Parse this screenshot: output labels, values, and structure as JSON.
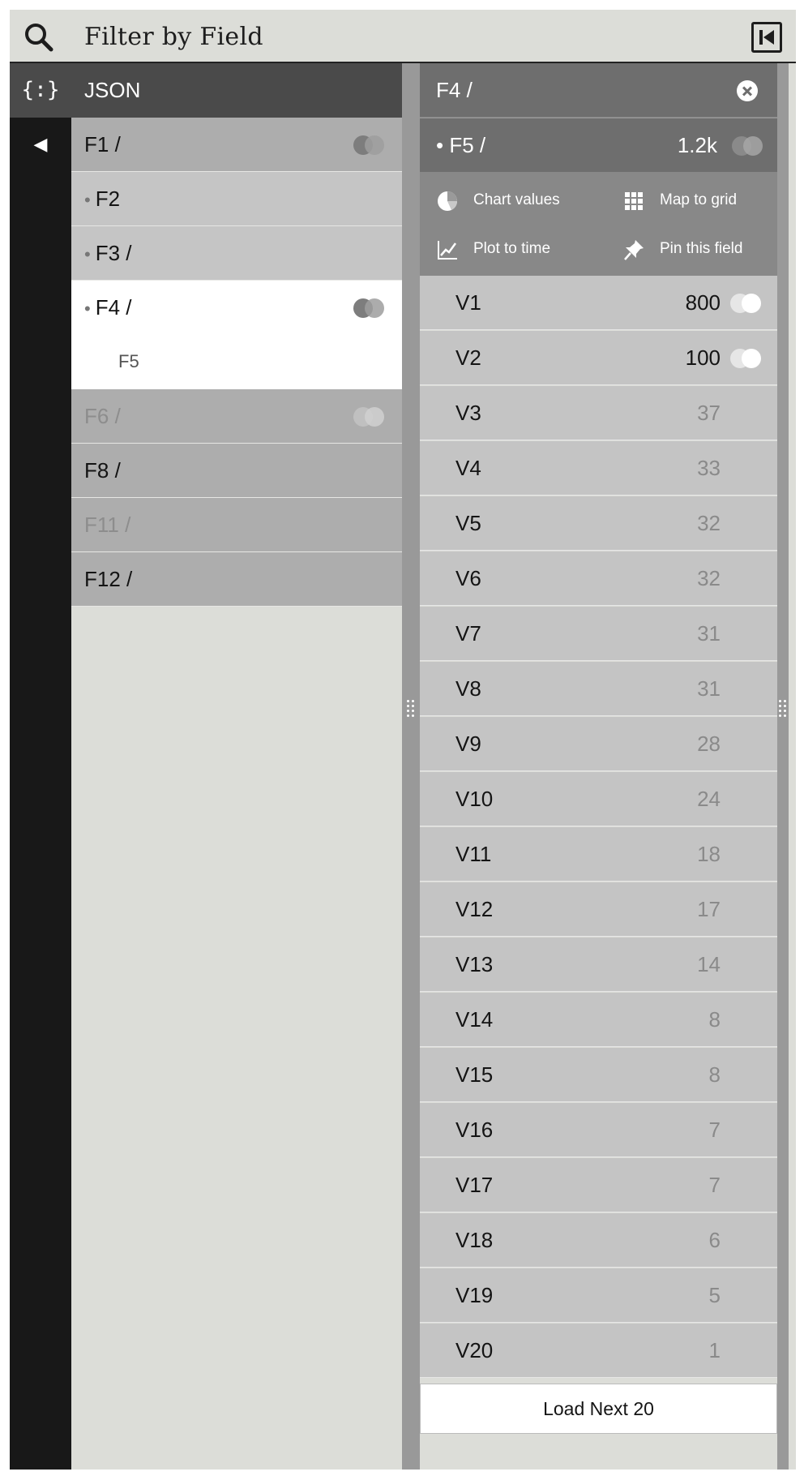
{
  "header": {
    "search_icon": "search-icon",
    "title": "Filter by Field",
    "collapse_icon": "skip-to-start-icon"
  },
  "rail": {
    "json_icon_text": "{:}",
    "back_icon": "◀"
  },
  "field_list": {
    "header": "JSON",
    "items": [
      {
        "label": "F1 /",
        "bullet": "",
        "style": "mid",
        "toggle": true
      },
      {
        "label": "F2",
        "bullet": "•",
        "style": "light",
        "toggle": false
      },
      {
        "label": "F3 /",
        "bullet": "•",
        "style": "light",
        "toggle": false
      },
      {
        "label": "F4 /",
        "bullet": "•",
        "style": "white",
        "toggle": true
      },
      {
        "label": "F5",
        "bullet": "",
        "style": "white-sub",
        "toggle": false
      },
      {
        "label": "F6 /",
        "bullet": "",
        "style": "dim",
        "toggle": true
      },
      {
        "label": "F8 /",
        "bullet": "",
        "style": "mid",
        "toggle": false
      },
      {
        "label": "F11 /",
        "bullet": "",
        "style": "dim",
        "toggle": false
      },
      {
        "label": "F12 /",
        "bullet": "",
        "style": "mid",
        "toggle": false
      }
    ]
  },
  "value_panel": {
    "path": "F4 /",
    "field": "• F5 /",
    "field_count": "1.2k",
    "actions": {
      "chart": "Chart values",
      "map": "Map to grid",
      "plot": "Plot to time",
      "pin": "Pin this field"
    },
    "values": [
      {
        "name": "V1",
        "count": "800",
        "toggle": true
      },
      {
        "name": "V2",
        "count": "100",
        "toggle": true
      },
      {
        "name": "V3",
        "count": "37",
        "toggle": false
      },
      {
        "name": "V4",
        "count": "33",
        "toggle": false
      },
      {
        "name": "V5",
        "count": "32",
        "toggle": false
      },
      {
        "name": "V6",
        "count": "32",
        "toggle": false
      },
      {
        "name": "V7",
        "count": "31",
        "toggle": false
      },
      {
        "name": "V8",
        "count": "31",
        "toggle": false
      },
      {
        "name": "V9",
        "count": "28",
        "toggle": false
      },
      {
        "name": "V10",
        "count": "24",
        "toggle": false
      },
      {
        "name": "V11",
        "count": "18",
        "toggle": false
      },
      {
        "name": "V12",
        "count": "17",
        "toggle": false
      },
      {
        "name": "V13",
        "count": "14",
        "toggle": false
      },
      {
        "name": "V14",
        "count": "8",
        "toggle": false
      },
      {
        "name": "V15",
        "count": "8",
        "toggle": false
      },
      {
        "name": "V16",
        "count": "7",
        "toggle": false
      },
      {
        "name": "V17",
        "count": "7",
        "toggle": false
      },
      {
        "name": "V18",
        "count": "6",
        "toggle": false
      },
      {
        "name": "V19",
        "count": "5",
        "toggle": false
      },
      {
        "name": "V20",
        "count": "1",
        "toggle": false
      }
    ],
    "load_more": "Load Next 20"
  }
}
